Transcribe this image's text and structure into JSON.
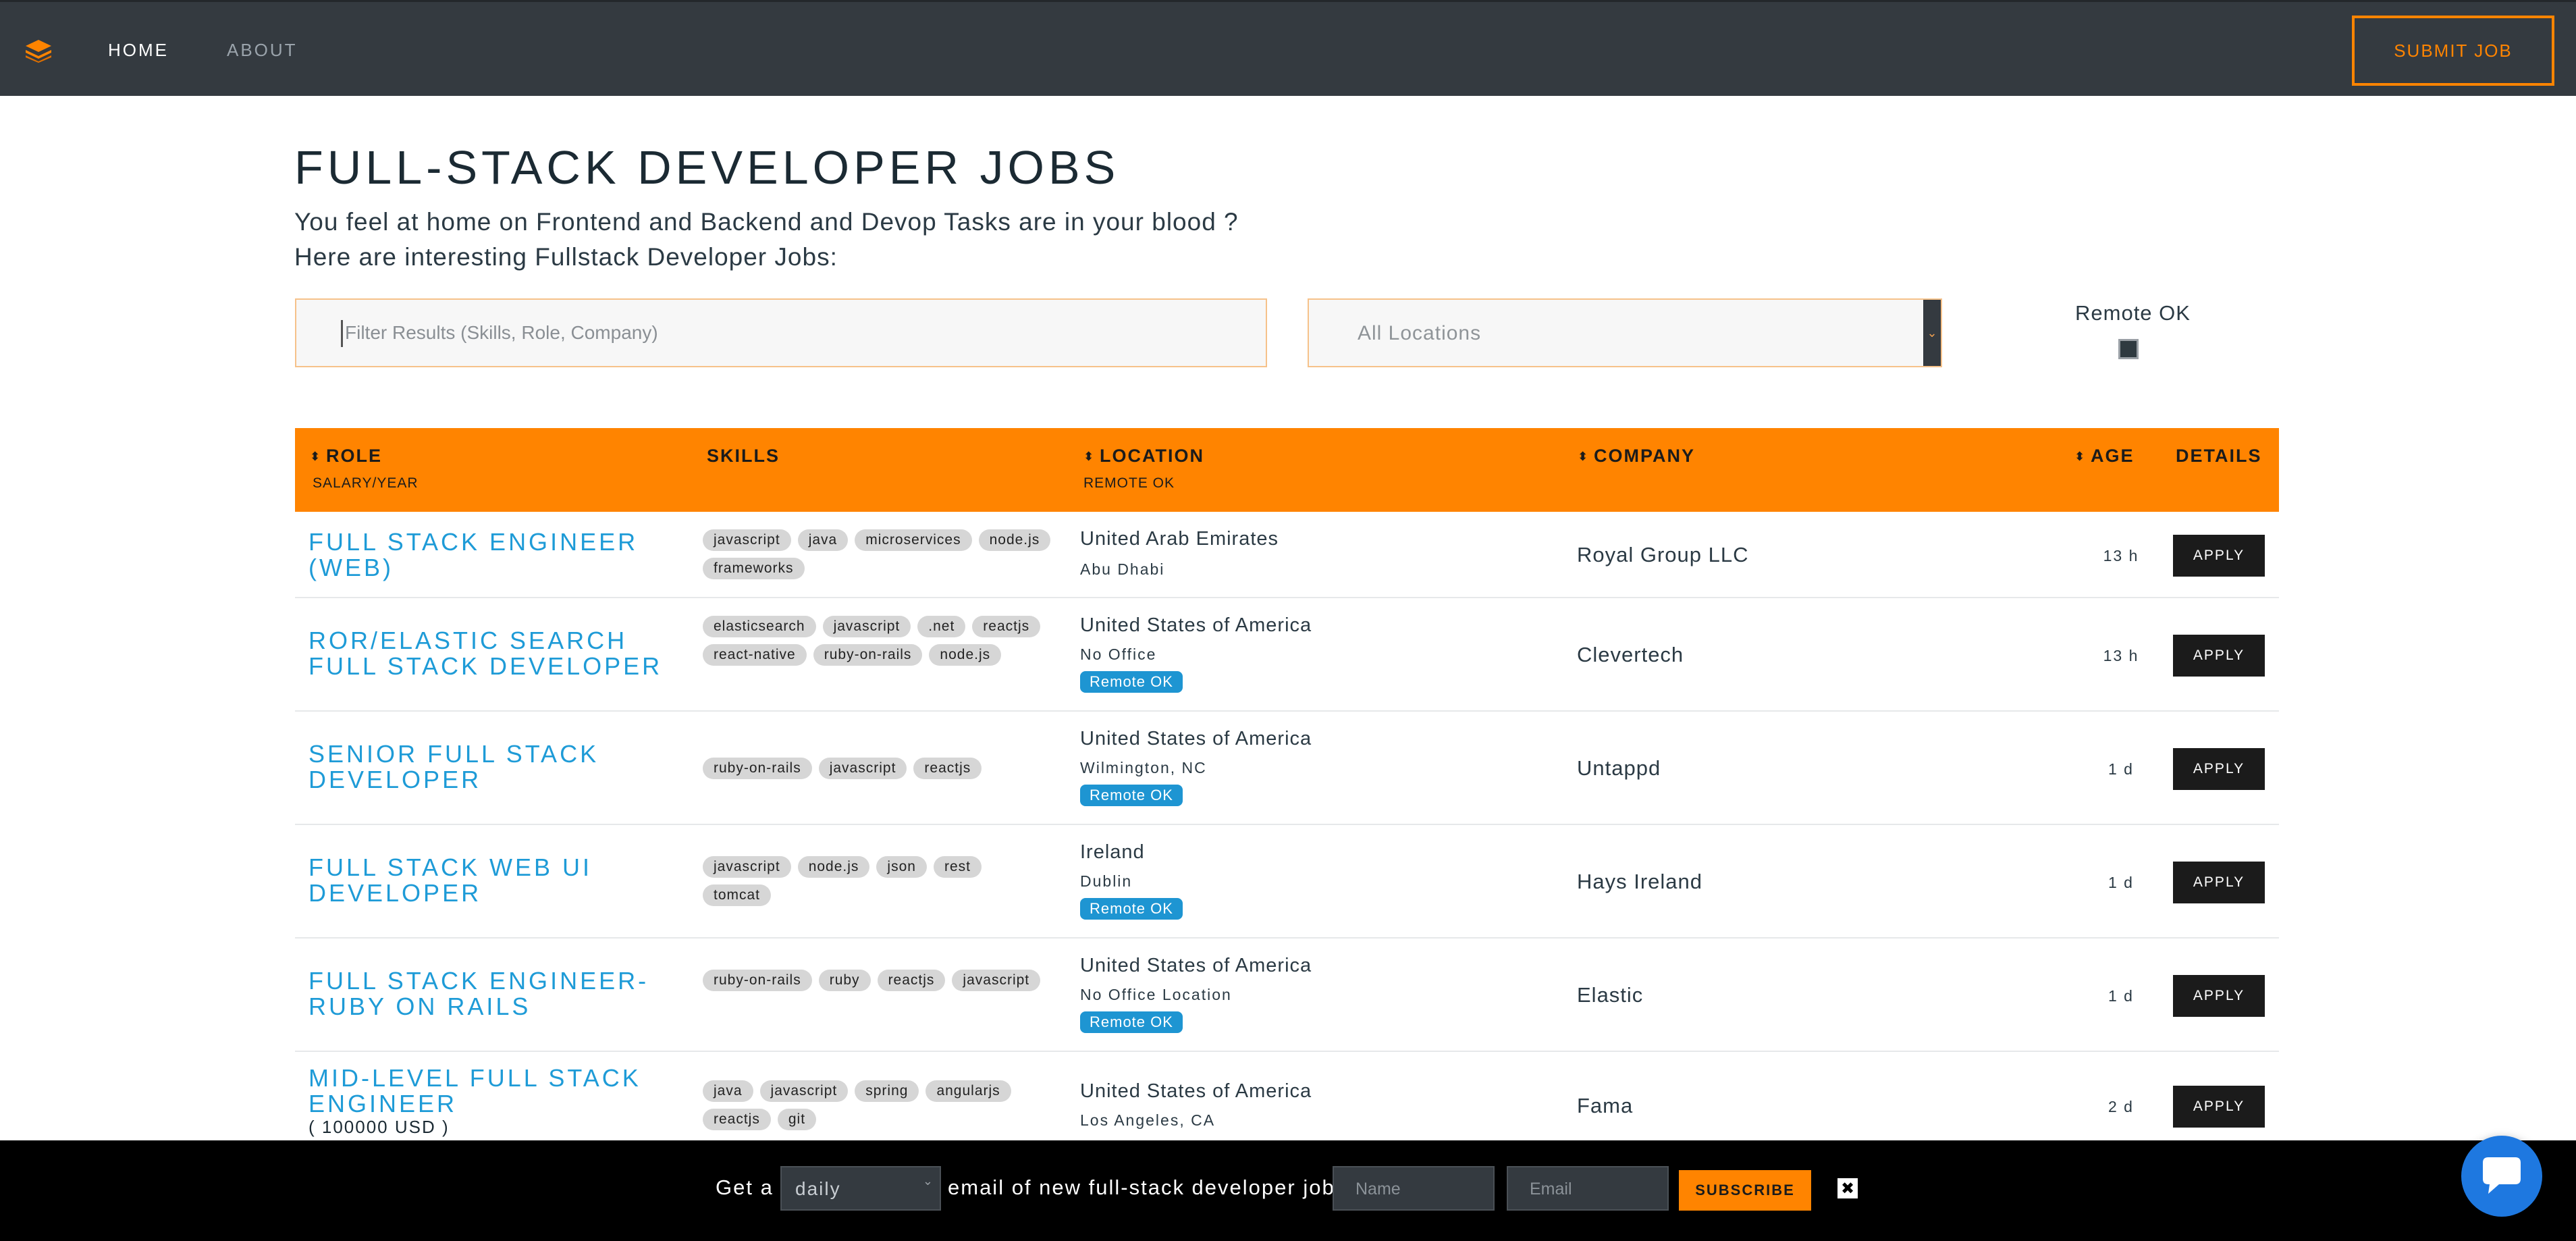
{
  "nav": {
    "home": "HOME",
    "about": "ABOUT",
    "submit": "SUBMIT JOB"
  },
  "header": {
    "title": "FULL-STACK DEVELOPER JOBS",
    "subtitle1": "You feel at home on Frontend and Backend and Devop Tasks are in your blood ?",
    "subtitle2": "Here are interesting Fullstack Developer Jobs:"
  },
  "filters": {
    "search_placeholder": "Filter Results (Skills, Role, Company)",
    "location_value": "All Locations",
    "remote_label": "Remote OK"
  },
  "table": {
    "headers": {
      "role": "ROLE",
      "role_sub": "SALARY/YEAR",
      "skills": "SKILLS",
      "location": "LOCATION",
      "location_sub": "REMOTE OK",
      "company": "COMPANY",
      "age": "AGE",
      "details": "DETAILS"
    },
    "apply_label": "APPLY",
    "rows": [
      {
        "role": "FULL STACK ENGINEER (WEB)",
        "salary": "",
        "skills": [
          "javascript",
          "java",
          "microservices",
          "node.js",
          "frameworks"
        ],
        "country": "United Arab Emirates",
        "city": "Abu Dhabi",
        "remote": "",
        "company": "Royal Group LLC",
        "age": "13 h"
      },
      {
        "role": "ROR/ELASTIC SEARCH FULL STACK DEVELOPER",
        "salary": "",
        "skills": [
          "elasticsearch",
          "javascript",
          ".net",
          "reactjs",
          "react-native",
          "ruby-on-rails",
          "node.js"
        ],
        "country": "United States of America",
        "city": "No Office",
        "remote": "Remote OK",
        "company": "Clevertech",
        "age": "13 h"
      },
      {
        "role": "SENIOR FULL STACK DEVELOPER",
        "salary": "",
        "skills": [
          "ruby-on-rails",
          "javascript",
          "reactjs"
        ],
        "country": "United States of America",
        "city": "Wilmington, NC",
        "remote": "Remote OK",
        "company": "Untappd",
        "age": "1 d"
      },
      {
        "role": "FULL STACK WEB UI DEVELOPER",
        "salary": "",
        "skills": [
          "javascript",
          "node.js",
          "json",
          "rest",
          "tomcat"
        ],
        "country": "Ireland",
        "city": "Dublin",
        "remote": "Remote OK",
        "company": "Hays Ireland",
        "age": "1 d"
      },
      {
        "role": "FULL STACK ENGINEER- RUBY ON RAILS",
        "salary": "",
        "skills": [
          "ruby-on-rails",
          "ruby",
          "reactjs",
          "javascript"
        ],
        "country": "United States of America",
        "city": "No Office Location",
        "remote": "Remote OK",
        "company": "Elastic",
        "age": "1 d"
      },
      {
        "role": "MID-LEVEL FULL STACK ENGINEER",
        "salary": "( 100000 USD )",
        "skills": [
          "java",
          "javascript",
          "spring",
          "angularjs",
          "reactjs",
          "git"
        ],
        "country": "United States of America",
        "city": "Los Angeles, CA",
        "remote": "",
        "company": "Fama",
        "age": "2 d"
      }
    ]
  },
  "subscribe": {
    "get_a": "Get a",
    "frequency": "daily",
    "text": "email of new full-stack developer jobs",
    "name_placeholder": "Name",
    "email_placeholder": "Email",
    "button": "SUBSCRIBE",
    "close": "✖"
  },
  "colors": {
    "accent": "#ff8400",
    "link": "#1e9bd7",
    "nav_bg": "#343a40"
  },
  "icons": {
    "logo": "stack-logo-icon",
    "chat": "chat-bubble-icon",
    "sort": "sort-icon"
  }
}
